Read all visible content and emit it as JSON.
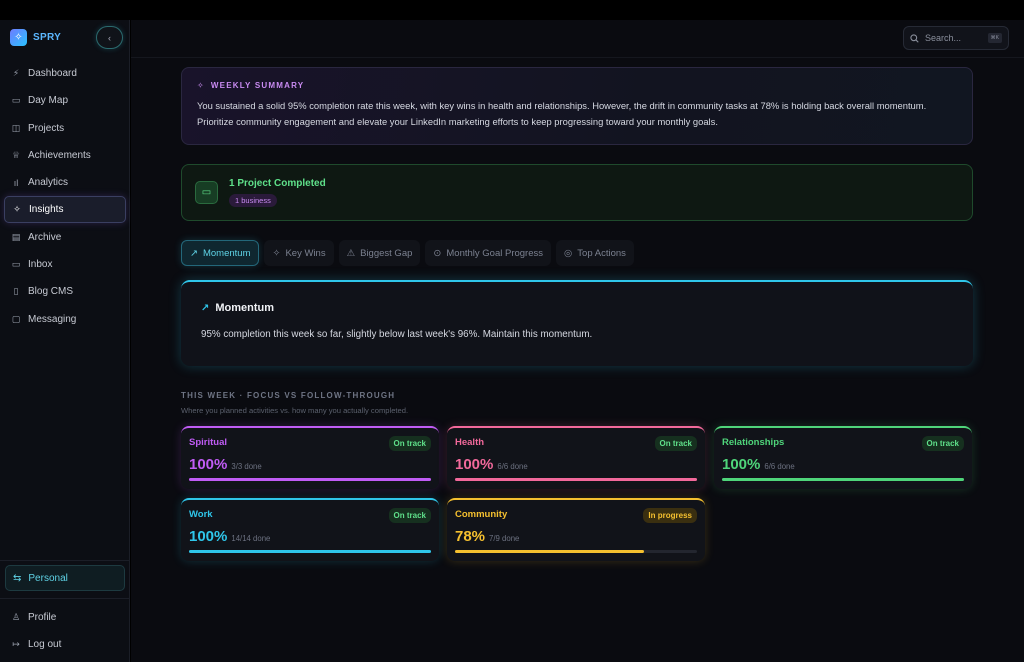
{
  "brand": {
    "name": "SPRY",
    "collapse_icon": "‹"
  },
  "sidebar": {
    "items": [
      {
        "label": "Dashboard",
        "icon": "⚡"
      },
      {
        "label": "Day Map",
        "icon": "▭"
      },
      {
        "label": "Projects",
        "icon": "◫"
      },
      {
        "label": "Achievements",
        "icon": "♕"
      },
      {
        "label": "Analytics",
        "icon": "ıl"
      },
      {
        "label": "Insights",
        "icon": "✧",
        "active": true
      },
      {
        "label": "Archive",
        "icon": "▤"
      },
      {
        "label": "Inbox",
        "icon": "▭"
      },
      {
        "label": "Blog CMS",
        "icon": "▯"
      },
      {
        "label": "Messaging",
        "icon": "▢"
      }
    ],
    "workspace": {
      "label": "Personal",
      "icon": "⇆"
    },
    "profile": {
      "label": "Profile",
      "icon": "♙"
    },
    "logout": {
      "label": "Log out",
      "icon": "↦"
    }
  },
  "search": {
    "placeholder": "Search...",
    "shortcut": "⌘K"
  },
  "summary": {
    "title": "WEEKLY SUMMARY",
    "line1": "You sustained a solid 95% completion rate this week, with key wins in health and relationships. However, the drift in community tasks at 78% is holding back overall momentum.",
    "line2": "Prioritize community engagement and elevate your LinkedIn marketing efforts to keep progressing toward your monthly goals."
  },
  "project": {
    "title": "1 Project Completed",
    "tag": "1 business"
  },
  "tabs": [
    {
      "label": "Momentum",
      "icon": "↗",
      "active": true
    },
    {
      "label": "Key Wins",
      "icon": "✧"
    },
    {
      "label": "Biggest Gap",
      "icon": "⚠"
    },
    {
      "label": "Monthly Goal Progress",
      "icon": "⊙"
    },
    {
      "label": "Top Actions",
      "icon": "◎"
    }
  ],
  "momentum": {
    "title": "Momentum",
    "text": "95% completion this week so far, slightly below last week's 96%. Maintain this momentum."
  },
  "focus": {
    "title": "THIS WEEK · FOCUS VS FOLLOW-THROUGH",
    "subtitle": "Where you planned activities vs. how many you actually completed.",
    "cards": [
      {
        "name": "Spiritual",
        "badge": "On track",
        "pct": "100%",
        "done": "3/3 done",
        "progress": 1.0,
        "color": "#c05cf5",
        "badge_color": "#5fe08a",
        "badge_bg": "#16301f"
      },
      {
        "name": "Health",
        "badge": "On track",
        "pct": "100%",
        "done": "6/6 done",
        "progress": 1.0,
        "color": "#f2699b",
        "badge_color": "#5fe08a",
        "badge_bg": "#16301f"
      },
      {
        "name": "Relationships",
        "badge": "On track",
        "pct": "100%",
        "done": "6/6 done",
        "progress": 1.0,
        "color": "#4fd57a",
        "badge_color": "#5fe08a",
        "badge_bg": "#16301f"
      },
      {
        "name": "Work",
        "badge": "On track",
        "pct": "100%",
        "done": "14/14 done",
        "progress": 1.0,
        "color": "#2fc6ea",
        "badge_color": "#5fe08a",
        "badge_bg": "#16301f"
      },
      {
        "name": "Community",
        "badge": "In progress",
        "pct": "78%",
        "done": "7/9 done",
        "progress": 0.78,
        "color": "#f5c02f",
        "badge_color": "#f5c02f",
        "badge_bg": "#3a2f10"
      }
    ]
  }
}
